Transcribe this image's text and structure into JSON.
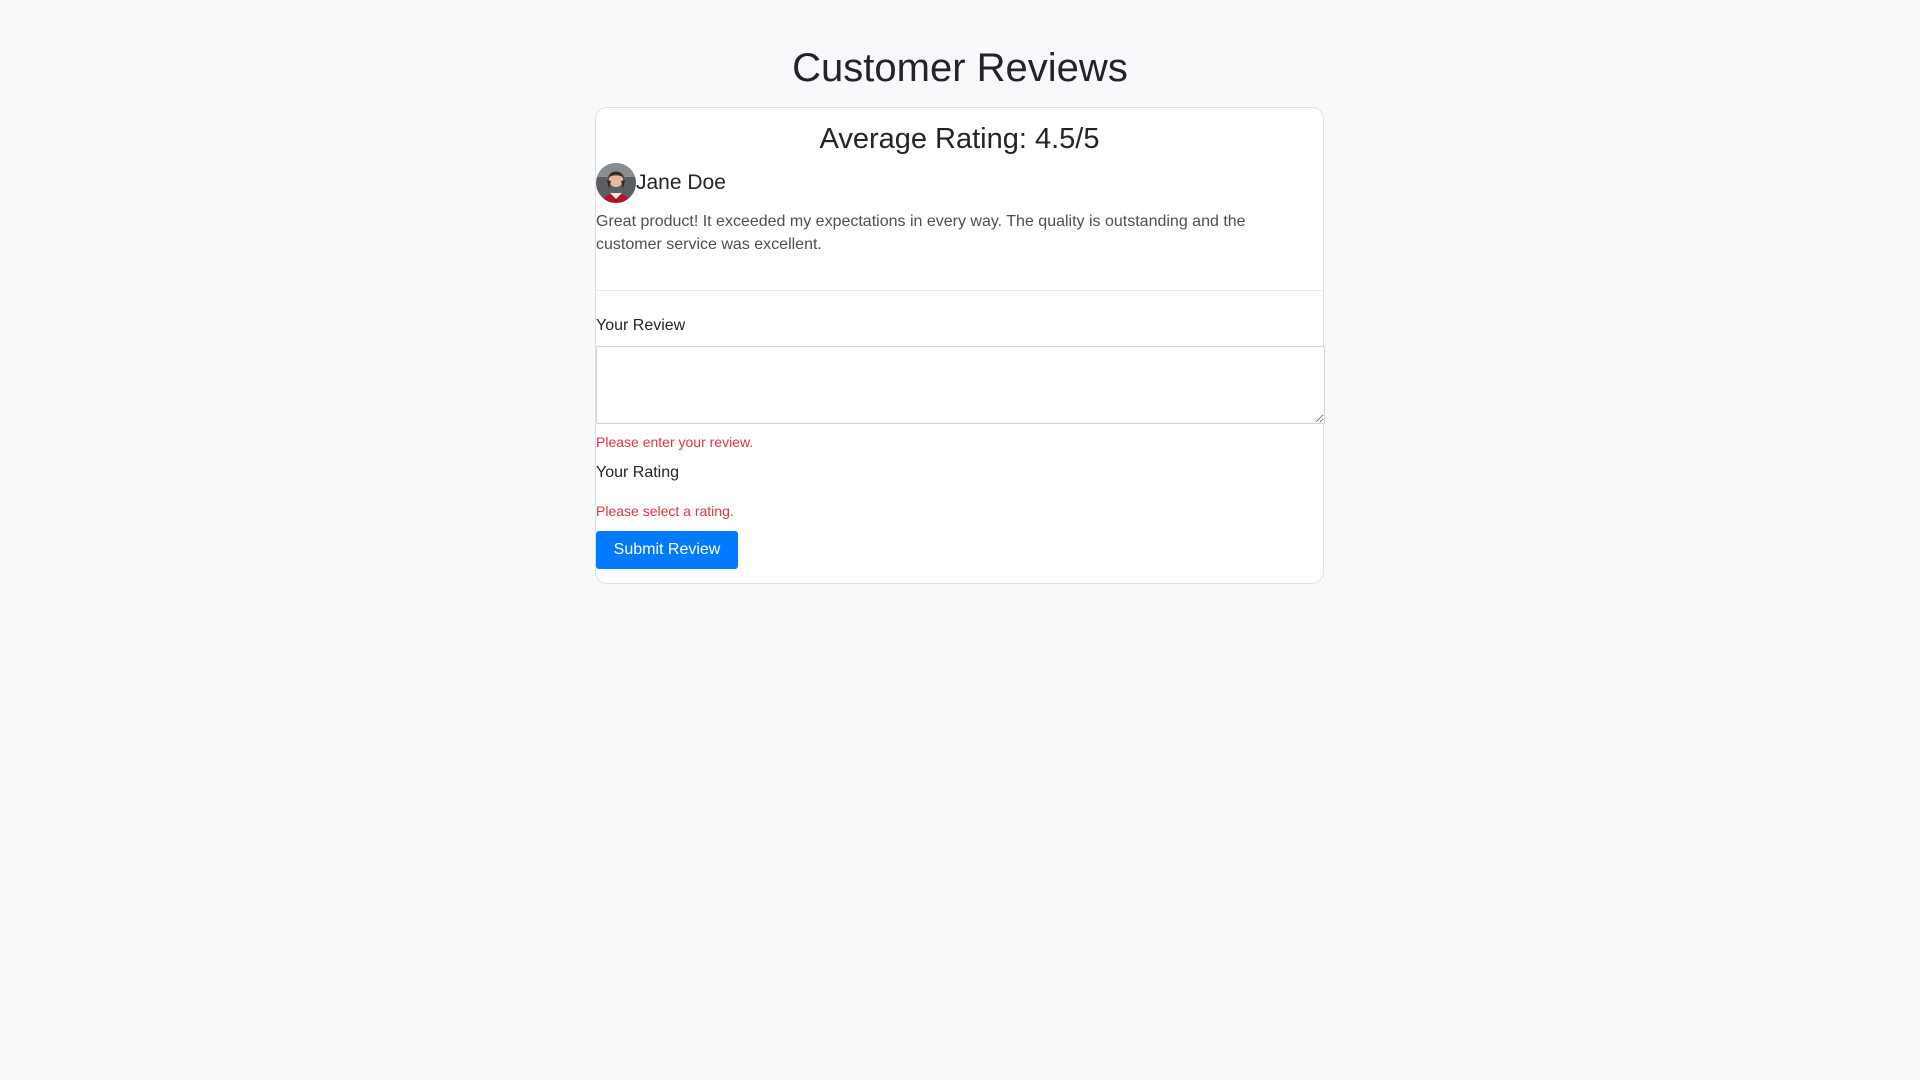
{
  "page": {
    "title": "Customer Reviews"
  },
  "summary": {
    "average_rating_text": "Average Rating: 4.5/5",
    "average_rating": 4.5,
    "max_rating": 5
  },
  "review": {
    "reviewer_name": "Jane Doe",
    "avatar_icon": "user-avatar-photo",
    "text": "Great product! It exceeded my expectations in every way. The quality is outstanding and the customer service was excellent."
  },
  "form": {
    "review_label": "Your Review",
    "review_value": "",
    "review_error": "Please enter your review.",
    "rating_label": "Your Rating",
    "rating_error": "Please select a rating.",
    "submit_label": "Submit Review"
  },
  "colors": {
    "background": "#f8f9fa",
    "accent": "#007bff",
    "error": "#dc3545"
  }
}
